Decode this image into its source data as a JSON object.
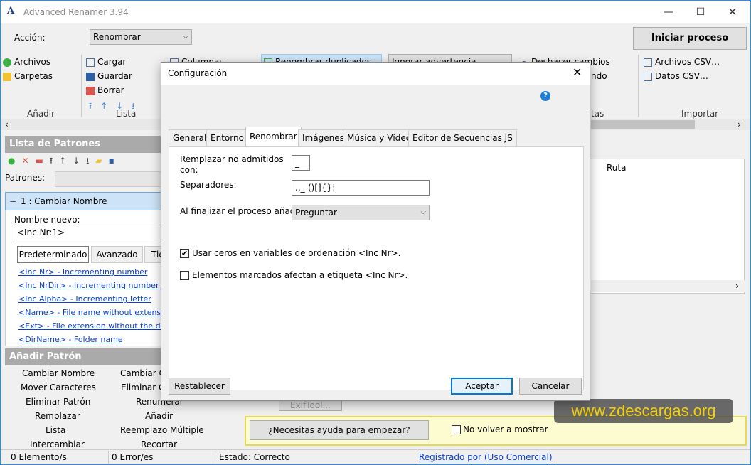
{
  "app": {
    "title": "Advanced Renamer 3.94"
  },
  "toolbar": {
    "accion_label": "Acción:",
    "accion_value": "Renombrar",
    "start_button": "Iniciar proceso",
    "add_files": "Archivos",
    "add_folders": "Carpetas",
    "add_group": "Añadir",
    "load": "Cargar",
    "save": "Guardar",
    "delete": "Borrar",
    "list_group": "Lista",
    "columns": "Columnas",
    "rename_duplicates": "Renombrar duplicados",
    "ignore_warning": "Ignorar advertencia",
    "undo_changes": "Deshacer cambios",
    "undo_partial": "ndo",
    "tas_partial": "tas",
    "csv_files": "Archivos CSV…",
    "csv_data": "Datos CSV…",
    "import_group": "Importar"
  },
  "patterns": {
    "header": "Lista de Patrones",
    "patrones_label": "Patrones:",
    "method_title": "1 : Cambiar Nombre",
    "method_collapse": "−",
    "new_name_label": "Nombre nuevo:",
    "new_name_value": "<Inc Nr:1>",
    "subtabs": [
      "Predeterminado",
      "Avanzado",
      "Tie"
    ],
    "tags": [
      "<Inc Nr> - Incrementing number",
      "<Inc NrDir> - Incrementing number p",
      "<Inc Alpha> - Incrementing letter",
      "<Name> - File name without extensio",
      "<Ext> - File extension without the dot",
      "<DirName> - Folder name"
    ]
  },
  "add_pattern": {
    "header": "Añadir Patrón",
    "col1": [
      "Cambiar Nombre",
      "Mover Caracteres",
      "Eliminar Patrón",
      "Remplazar",
      "Lista",
      "Intercambiar"
    ],
    "col2": [
      "Cambiar Ca",
      "Eliminar Ca",
      "Renumerar",
      "Añadir",
      "Reemplazo Múltiple",
      "Recortar"
    ]
  },
  "files": {
    "col_ruta": "Ruta",
    "exiftool": "ExifTool..."
  },
  "help": {
    "button": "¿Necesitas ayuda para empezar?",
    "no_show": "No volver a mostrar"
  },
  "watermark": "www.zdescargas.org",
  "status": {
    "elements": "0 Elemento/s",
    "errors": "0 Error/es",
    "state": "Estado: Correcto",
    "registered": "Registrado por  (Uso Comercial)"
  },
  "dialog": {
    "title": "Configuración",
    "help_icon": "?",
    "tabs": [
      "General",
      "Entorno",
      "Renombrar",
      "Imágenes",
      "Música y Vídeo",
      "Editor de Secuencias JS"
    ],
    "replace_label_1": "Remplazar no admitidos",
    "replace_label_2": "con:",
    "replace_value": "_",
    "separators_label": "Separadores:",
    "separators_value": ".,_-()[]{}!",
    "finish_label": "Al finalizar el proceso añadir:",
    "finish_value": "Preguntar",
    "check1_label": "Usar ceros en variables de ordenación <Inc Nr>.",
    "check1_checked": true,
    "check2_label": "Elementos marcados afectan a etiqueta <Inc Nr>.",
    "check2_checked": false,
    "reset": "Restablecer",
    "ok": "Aceptar",
    "cancel": "Cancelar"
  }
}
